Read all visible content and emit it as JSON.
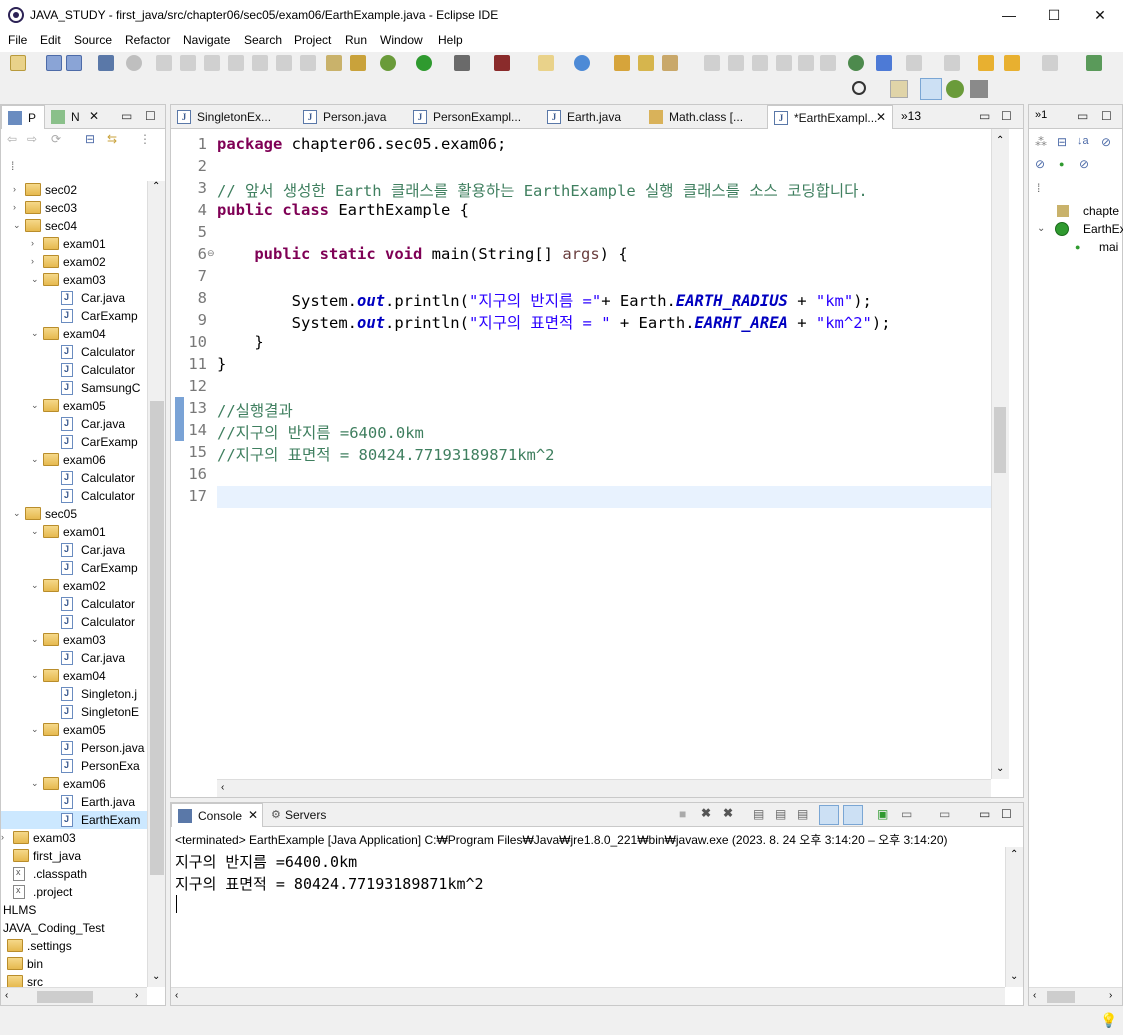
{
  "window": {
    "title": "JAVA_STUDY - first_java/src/chapter06/sec05/exam06/EarthExample.java - Eclipse IDE",
    "minimize": "—",
    "maximize": "☐",
    "close": "✕"
  },
  "menu": [
    "File",
    "Edit",
    "Source",
    "Refactor",
    "Navigate",
    "Search",
    "Project",
    "Run",
    "Window",
    "Help"
  ],
  "left_panel": {
    "tabs": [
      "P",
      "N"
    ],
    "tree": [
      {
        "label": "sec02",
        "type": "pkg",
        "depth": 1,
        "twisty": "›"
      },
      {
        "label": "sec03",
        "type": "pkg",
        "depth": 1,
        "twisty": "›"
      },
      {
        "label": "sec04",
        "type": "pkg",
        "depth": 1,
        "twisty": "⌄"
      },
      {
        "label": "exam01",
        "type": "pkg",
        "depth": 2,
        "twisty": "›"
      },
      {
        "label": "exam02",
        "type": "pkg",
        "depth": 2,
        "twisty": "›"
      },
      {
        "label": "exam03",
        "type": "pkg",
        "depth": 2,
        "twisty": "⌄"
      },
      {
        "label": "Car.java",
        "type": "java",
        "depth": 3,
        "twisty": ""
      },
      {
        "label": "CarExamp",
        "type": "java",
        "depth": 3,
        "twisty": ""
      },
      {
        "label": "exam04",
        "type": "pkg",
        "depth": 2,
        "twisty": "⌄"
      },
      {
        "label": "Calculator",
        "type": "java",
        "depth": 3,
        "twisty": ""
      },
      {
        "label": "Calculator",
        "type": "java",
        "depth": 3,
        "twisty": ""
      },
      {
        "label": "SamsungC",
        "type": "java",
        "depth": 3,
        "twisty": ""
      },
      {
        "label": "exam05",
        "type": "pkg",
        "depth": 2,
        "twisty": "⌄"
      },
      {
        "label": "Car.java",
        "type": "java",
        "depth": 3,
        "twisty": ""
      },
      {
        "label": "CarExamp",
        "type": "java",
        "depth": 3,
        "twisty": ""
      },
      {
        "label": "exam06",
        "type": "pkg",
        "depth": 2,
        "twisty": "⌄"
      },
      {
        "label": "Calculator",
        "type": "java",
        "depth": 3,
        "twisty": ""
      },
      {
        "label": "Calculator",
        "type": "java",
        "depth": 3,
        "twisty": ""
      },
      {
        "label": "sec05",
        "type": "pkg",
        "depth": 1,
        "twisty": "⌄"
      },
      {
        "label": "exam01",
        "type": "pkg",
        "depth": 2,
        "twisty": "⌄"
      },
      {
        "label": "Car.java",
        "type": "java",
        "depth": 3,
        "twisty": ""
      },
      {
        "label": "CarExamp",
        "type": "java",
        "depth": 3,
        "twisty": ""
      },
      {
        "label": "exam02",
        "type": "pkg",
        "depth": 2,
        "twisty": "⌄"
      },
      {
        "label": "Calculator",
        "type": "java",
        "depth": 3,
        "twisty": ""
      },
      {
        "label": "Calculator",
        "type": "java",
        "depth": 3,
        "twisty": ""
      },
      {
        "label": "exam03",
        "type": "pkg",
        "depth": 2,
        "twisty": "⌄"
      },
      {
        "label": "Car.java",
        "type": "java",
        "depth": 3,
        "twisty": ""
      },
      {
        "label": "exam04",
        "type": "pkg",
        "depth": 2,
        "twisty": "⌄"
      },
      {
        "label": "Singleton.j",
        "type": "java",
        "depth": 3,
        "twisty": ""
      },
      {
        "label": "SingletonE",
        "type": "java",
        "depth": 3,
        "twisty": ""
      },
      {
        "label": "exam05",
        "type": "pkg",
        "depth": 2,
        "twisty": "⌄"
      },
      {
        "label": "Person.java",
        "type": "java",
        "depth": 3,
        "twisty": ""
      },
      {
        "label": "PersonExa",
        "type": "java",
        "depth": 3,
        "twisty": ""
      },
      {
        "label": "exam06",
        "type": "pkg",
        "depth": 2,
        "twisty": "⌄"
      },
      {
        "label": "Earth.java",
        "type": "java",
        "depth": 3,
        "twisty": ""
      },
      {
        "label": "EarthExam",
        "type": "java",
        "depth": 3,
        "twisty": "",
        "selected": true
      },
      {
        "label": "exam03",
        "type": "folder",
        "depth": 0,
        "twisty": "›"
      },
      {
        "label": "first_java",
        "type": "folder",
        "depth": 0,
        "twisty": ""
      },
      {
        "label": ".classpath",
        "type": "xml",
        "depth": 0,
        "twisty": ""
      },
      {
        "label": ".project",
        "type": "xml",
        "depth": 0,
        "twisty": ""
      },
      {
        "label": "HLMS",
        "type": "proj",
        "depth": -1,
        "twisty": ""
      },
      {
        "label": "JAVA_Coding_Test",
        "type": "proj",
        "depth": -1,
        "twisty": ""
      },
      {
        "label": ".settings",
        "type": "folder",
        "depth": -1,
        "twisty": ""
      },
      {
        "label": "bin",
        "type": "folder",
        "depth": -1,
        "twisty": ""
      },
      {
        "label": "src",
        "type": "folder",
        "depth": -1,
        "twisty": ""
      }
    ]
  },
  "editor": {
    "tabs": [
      {
        "label": "SingletonEx...",
        "active": false
      },
      {
        "label": "Person.java",
        "active": false
      },
      {
        "label": "PersonExampl...",
        "active": false
      },
      {
        "label": "Earth.java",
        "active": false
      },
      {
        "label": "Math.class [...",
        "active": false
      },
      {
        "label": "*EarthExampl...",
        "active": true
      }
    ],
    "overflow": "»13",
    "lines": [
      {
        "n": "1",
        "html": "<span class='kw'>package</span> chapter06.sec05.exam06;"
      },
      {
        "n": "2",
        "html": ""
      },
      {
        "n": "3",
        "html": "<span class='cm'>// 앞서 생성한 Earth 클래스를 활용하는 EarthExample 실행 클래스를 소스 코딩합니다.</span>"
      },
      {
        "n": "4",
        "html": "<span class='kw'>public</span> <span class='kw'>class</span> EarthExample {"
      },
      {
        "n": "5",
        "html": ""
      },
      {
        "n": "6",
        "html": "    <span class='kw'>public</span> <span class='kw'>static</span> <span class='kw'>void</span> main(String[] <span class='ps'>args</span>) {"
      },
      {
        "n": "7",
        "html": ""
      },
      {
        "n": "8",
        "html": "        System.<span class='sf'>out</span>.println(<span class='st'>\"지구의 반지름 =\"</span>+ Earth.<span class='sf'>EARTH_RADIUS</span> + <span class='st'>\"km\"</span>);"
      },
      {
        "n": "9",
        "html": "        System.<span class='sf'>out</span>.println(<span class='st'>\"지구의 표면적 = \"</span> + Earth.<span class='sf'>EARHT_AREA</span> + <span class='st'>\"km^2\"</span>);"
      },
      {
        "n": "10",
        "html": "    }"
      },
      {
        "n": "11",
        "html": "}"
      },
      {
        "n": "12",
        "html": ""
      },
      {
        "n": "13",
        "html": "<span class='cm'>//실행결과</span>"
      },
      {
        "n": "14",
        "html": "<span class='cm'>//지구의 반지름 =6400.0km</span>"
      },
      {
        "n": "15",
        "html": "<span class='cm'>//지구의 표면적 = 80424.77193189871km^2</span>"
      },
      {
        "n": "16",
        "html": ""
      },
      {
        "n": "17",
        "html": ""
      }
    ]
  },
  "outline": {
    "items": [
      "chapte",
      "EarthEx",
      "mai"
    ]
  },
  "console": {
    "tabs": [
      "Console",
      "Servers"
    ],
    "status": "<terminated> EarthExample [Java Application] C:₩Program Files₩Java₩jre1.8.0_221₩bin₩javaw.exe  (2023. 8. 24 오후 3:14:20 – 오후 3:14:20)",
    "output": [
      "지구의 반지름 =6400.0km",
      "지구의 표면적 = 80424.77193189871km^2"
    ]
  }
}
